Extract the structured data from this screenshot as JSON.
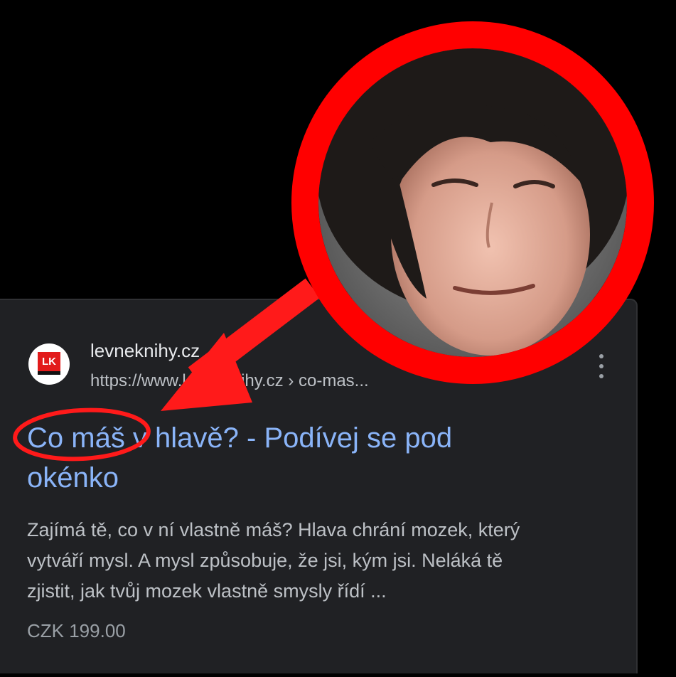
{
  "result": {
    "favicon_text": "LK",
    "site_name": "levneknihy.cz",
    "url": "https://www.levneknihy.cz › co-mas...",
    "title_line1": "Co máš v hlavě? - Podívej se pod",
    "title_line2": "okénko",
    "snippet_line1": "Zajímá tě, co v ní vlastně máš? Hlava chrání mozek, který",
    "snippet_line2": "vytváří mysl. A mysl způsobuje, že jsi, kým jsi. Neláká tě",
    "snippet_line3": "zjistit, jak tvůj mozek vlastně smysly řídí ...",
    "price": "CZK 199.00"
  },
  "colors": {
    "background": "#000000",
    "card": "#202124",
    "title_link": "#8ab4f8",
    "snippet_text": "#bdc1c6",
    "annotation_red": "#ff0000",
    "brand_red": "#e21b1b"
  },
  "icons": {
    "favicon": "levneknihy-logo-icon",
    "menu": "more-vert-icon"
  },
  "annotations": {
    "photo_circle": "red-circle-photo-frame",
    "arrow": "red-arrow",
    "highlight": "red-ellipse-highlight"
  }
}
